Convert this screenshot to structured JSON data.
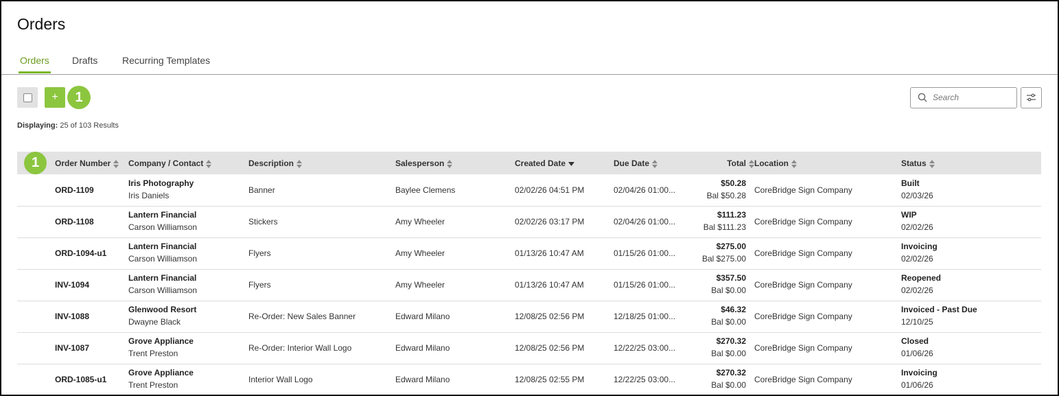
{
  "page": {
    "title": "Orders"
  },
  "tabs": [
    {
      "label": "Orders",
      "active": true
    },
    {
      "label": "Drafts",
      "active": false
    },
    {
      "label": "Recurring Templates",
      "active": false
    }
  ],
  "toolbar": {
    "add_label": "+",
    "badge_number": "1",
    "search_placeholder": "Search",
    "icons": {
      "search": "search-icon",
      "filter": "sliders-icon"
    }
  },
  "results": {
    "prefix": "Displaying:",
    "text": "25 of 103 Results"
  },
  "table": {
    "badge_number": "1",
    "columns": [
      {
        "label": "Order Number",
        "sort": "both"
      },
      {
        "label": "Company / Contact",
        "sort": "both"
      },
      {
        "label": "Description",
        "sort": "both"
      },
      {
        "label": "Salesperson",
        "sort": "both"
      },
      {
        "label": "Created Date",
        "sort": "desc"
      },
      {
        "label": "Due Date",
        "sort": "both"
      },
      {
        "label": "Total",
        "sort": "both"
      },
      {
        "label": "Location",
        "sort": "both"
      },
      {
        "label": "Status",
        "sort": "both"
      }
    ],
    "rows": [
      {
        "order": "ORD-1109",
        "company": "Iris Photography",
        "contact": "Iris Daniels",
        "description": "Banner",
        "salesperson": "Baylee Clemens",
        "created": "02/02/26 04:51 PM",
        "due": "02/04/26 01:00...",
        "total": "$50.28",
        "balance": "Bal $50.28",
        "location": "CoreBridge Sign Company",
        "status": "Built",
        "status_date": "02/03/26"
      },
      {
        "order": "ORD-1108",
        "company": "Lantern Financial",
        "contact": "Carson Williamson",
        "description": "Stickers",
        "salesperson": "Amy Wheeler",
        "created": "02/02/26 03:17 PM",
        "due": "02/04/26 01:00...",
        "total": "$111.23",
        "balance": "Bal $111.23",
        "location": "CoreBridge Sign Company",
        "status": "WIP",
        "status_date": "02/02/26"
      },
      {
        "order": "ORD-1094-u1",
        "company": "Lantern Financial",
        "contact": "Carson Williamson",
        "description": "Flyers",
        "salesperson": "Amy Wheeler",
        "created": "01/13/26 10:47 AM",
        "due": "01/15/26 01:00...",
        "total": "$275.00",
        "balance": "Bal $275.00",
        "location": "CoreBridge Sign Company",
        "status": "Invoicing",
        "status_date": "02/02/26"
      },
      {
        "order": "INV-1094",
        "company": "Lantern Financial",
        "contact": "Carson Williamson",
        "description": "Flyers",
        "salesperson": "Amy Wheeler",
        "created": "01/13/26 10:47 AM",
        "due": "01/15/26 01:00...",
        "total": "$357.50",
        "balance": "Bal $0.00",
        "location": "CoreBridge Sign Company",
        "status": "Reopened",
        "status_date": "02/02/26"
      },
      {
        "order": "INV-1088",
        "company": "Glenwood Resort",
        "contact": "Dwayne Black",
        "description": "Re-Order: New Sales Banner",
        "salesperson": "Edward Milano",
        "created": "12/08/25 02:56 PM",
        "due": "12/18/25 01:00...",
        "total": "$46.32",
        "balance": "Bal $0.00",
        "location": "CoreBridge Sign Company",
        "status": "Invoiced - Past Due",
        "status_date": "12/10/25"
      },
      {
        "order": "INV-1087",
        "company": "Grove Appliance",
        "contact": "Trent Preston",
        "description": "Re-Order: Interior Wall Logo",
        "salesperson": "Edward Milano",
        "created": "12/08/25 02:56 PM",
        "due": "12/22/25 03:00...",
        "total": "$270.32",
        "balance": "Bal $0.00",
        "location": "CoreBridge Sign Company",
        "status": "Closed",
        "status_date": "01/06/26"
      },
      {
        "order": "ORD-1085-u1",
        "company": "Grove Appliance",
        "contact": "Trent Preston",
        "description": "Interior Wall Logo",
        "salesperson": "Edward Milano",
        "created": "12/08/25 02:55 PM",
        "due": "12/22/25 03:00...",
        "total": "$270.32",
        "balance": "Bal $0.00",
        "location": "CoreBridge Sign Company",
        "status": "Invoicing",
        "status_date": "01/06/26"
      }
    ]
  },
  "colors": {
    "accent": "#8cc63f",
    "tab_active": "#6b9b1f",
    "header_bg": "#e3e3e3"
  }
}
